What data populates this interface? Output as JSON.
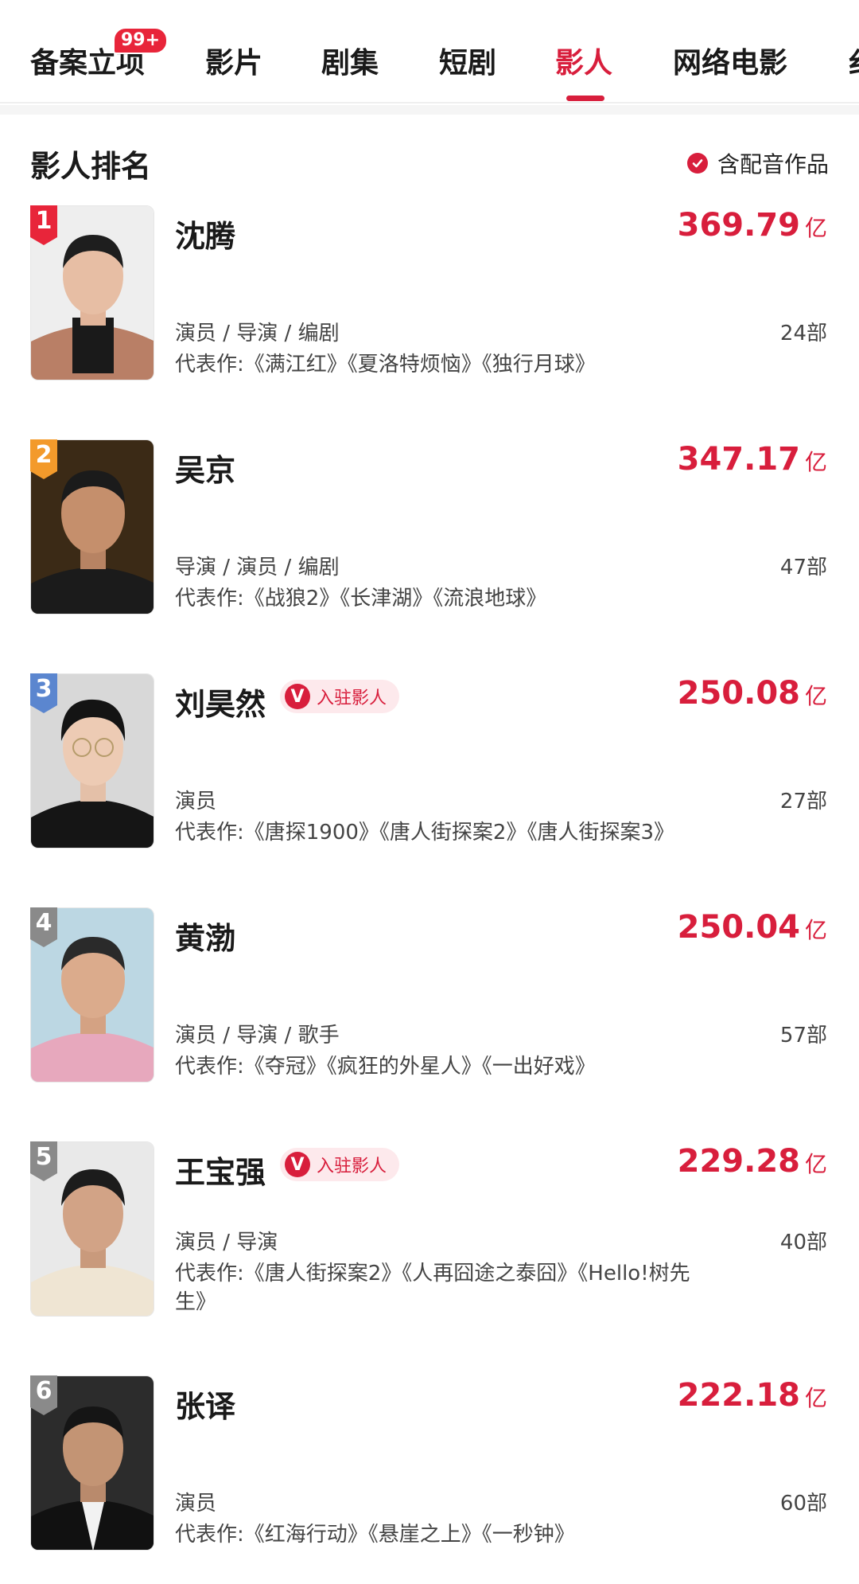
{
  "tabs": [
    {
      "label": "备案立项",
      "badge": "99+"
    },
    {
      "label": "影片"
    },
    {
      "label": "剧集"
    },
    {
      "label": "短剧"
    },
    {
      "label": "影人",
      "active": true
    },
    {
      "label": "网络电影"
    },
    {
      "label": "纟"
    }
  ],
  "section": {
    "title": "影人排名",
    "dub_label": "含配音作品"
  },
  "accent_color": "#d81e3c",
  "tag_label": "入驻影人",
  "people": [
    {
      "rank": "1",
      "name": "沈腾",
      "box": "369.79",
      "unit": "亿",
      "roles": "演员 / 导演 / 编剧",
      "count": "24部",
      "works": "代表作:《满江红》《夏洛特烦恼》《独行月球》",
      "verified": false
    },
    {
      "rank": "2",
      "name": "吴京",
      "box": "347.17",
      "unit": "亿",
      "roles": "导演 / 演员 / 编剧",
      "count": "47部",
      "works": "代表作:《战狼2》《长津湖》《流浪地球》",
      "verified": false
    },
    {
      "rank": "3",
      "name": "刘昊然",
      "box": "250.08",
      "unit": "亿",
      "roles": "演员",
      "count": "27部",
      "works": "代表作:《唐探1900》《唐人街探案2》《唐人街探案3》",
      "verified": true
    },
    {
      "rank": "4",
      "name": "黄渤",
      "box": "250.04",
      "unit": "亿",
      "roles": "演员 / 导演 / 歌手",
      "count": "57部",
      "works": "代表作:《夺冠》《疯狂的外星人》《一出好戏》",
      "verified": false
    },
    {
      "rank": "5",
      "name": "王宝强",
      "box": "229.28",
      "unit": "亿",
      "roles": "演员 / 导演",
      "count": "40部",
      "works": "代表作:《唐人街探案2》《人再囧途之泰囧》《Hello!树先生》",
      "verified": true
    },
    {
      "rank": "6",
      "name": "张译",
      "box": "222.18",
      "unit": "亿",
      "roles": "演员",
      "count": "60部",
      "works": "代表作:《红海行动》《悬崖之上》《一秒钟》",
      "verified": false
    }
  ]
}
